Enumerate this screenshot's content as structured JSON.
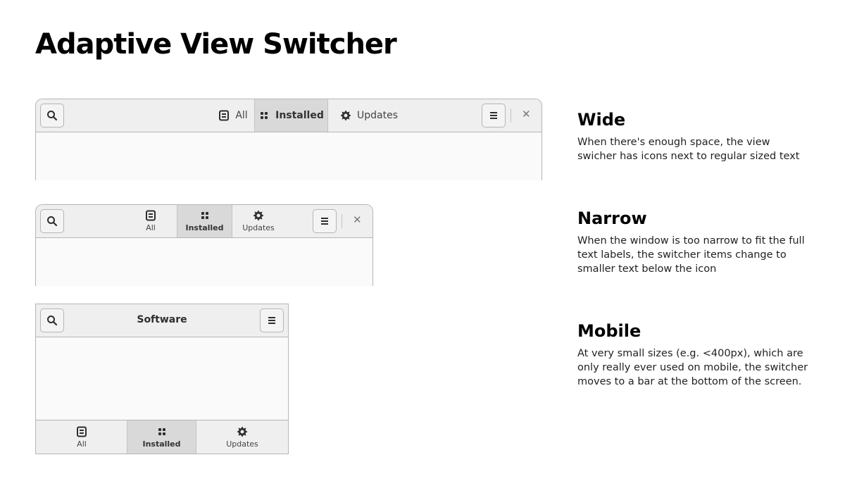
{
  "title": "Adaptive View Switcher",
  "tabs": [
    {
      "label": "All",
      "icon": "document-icon"
    },
    {
      "label": "Installed",
      "icon": "grid-icon",
      "selected": true
    },
    {
      "label": "Updates",
      "icon": "gear-icon"
    }
  ],
  "mobile_title": "Software",
  "close_glyph": "✕",
  "sections": [
    {
      "heading": "Wide",
      "text": "When there's enough space, the view swicher has icons next to regular sized text"
    },
    {
      "heading": "Narrow",
      "text": "When the window is too narrow to fit the full text labels, the switcher items change to smaller text below the icon"
    },
    {
      "heading": "Mobile",
      "text": "At very small sizes (e.g. <400px), which are only really ever used on mobile, the switcher moves to a bar at the bottom of the screen."
    }
  ]
}
